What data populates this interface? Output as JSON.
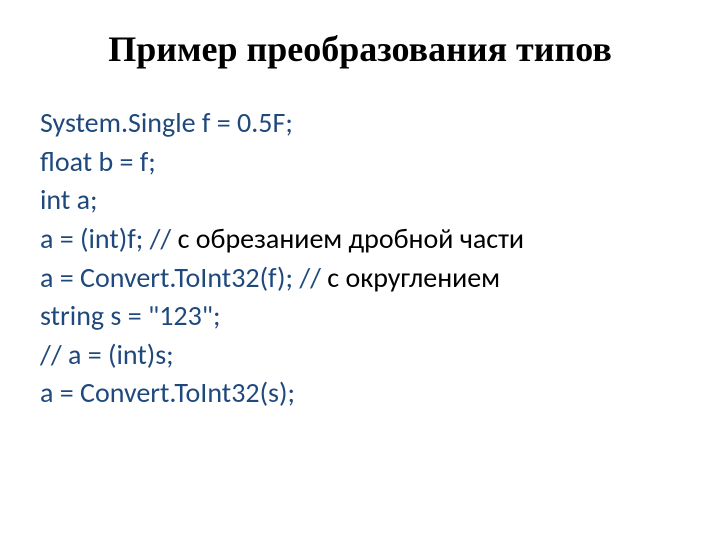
{
  "title": "Пример преобразования типов",
  "code": {
    "l1": "System.Single f = 0.5F;",
    "l2": "float b = f;",
    "l3": "int a;",
    "l4a": "a = (int)f; // ",
    "l4b": "с обрезанием дробной части",
    "l5a": "a = Convert.ToInt32(f); // ",
    "l5b": "с округлением",
    "l6": "string s = \"123\";",
    "l7": " // a = (int)s;",
    "l8": " a = Convert.ToInt32(s);"
  }
}
